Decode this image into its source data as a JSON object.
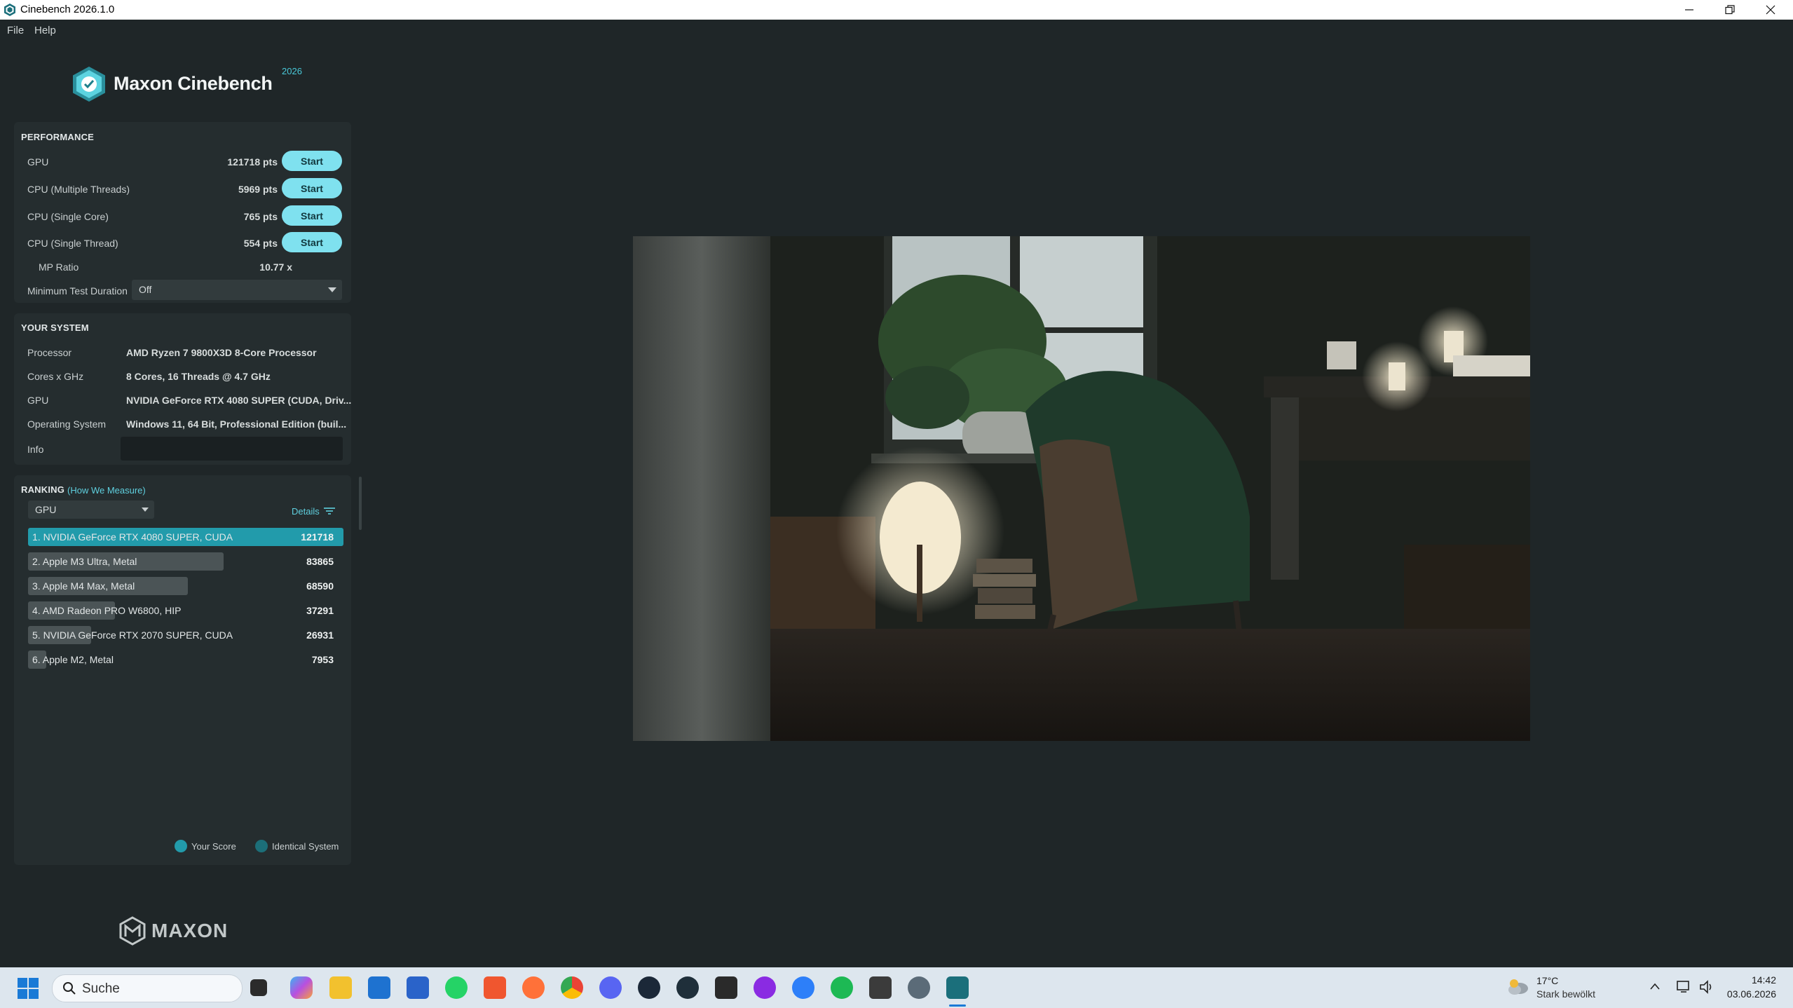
{
  "window": {
    "title": "Cinebench 2026.1.0",
    "controls": [
      "minimize",
      "restore",
      "close"
    ]
  },
  "menu": {
    "file": "File",
    "help": "Help"
  },
  "logo": {
    "brand": "Maxon Cinebench",
    "year": "2026"
  },
  "performance": {
    "heading": "PERFORMANCE",
    "tests": [
      {
        "label": "GPU",
        "score": "121718 pts",
        "button": "Start"
      },
      {
        "label": "CPU (Multiple Threads)",
        "score": "5969 pts",
        "button": "Start"
      },
      {
        "label": "CPU (Single Core)",
        "score": "765 pts",
        "button": "Start"
      },
      {
        "label": "CPU (Single Thread)",
        "score": "554 pts",
        "button": "Start"
      }
    ],
    "mp_ratio_label": "MP Ratio",
    "mp_ratio_value": "10.77 x",
    "min_duration_label": "Minimum Test Duration",
    "min_duration_value": "Off"
  },
  "system": {
    "heading": "YOUR SYSTEM",
    "rows": [
      {
        "label": "Processor",
        "value": "AMD Ryzen 7 9800X3D 8-Core Processor"
      },
      {
        "label": "Cores x GHz",
        "value": "8 Cores, 16 Threads @ 4.7 GHz"
      },
      {
        "label": "GPU",
        "value": "NVIDIA GeForce RTX 4080 SUPER (CUDA, Driv..."
      },
      {
        "label": "Operating System",
        "value": "Windows 11, 64 Bit, Professional Edition (buil..."
      }
    ],
    "info_label": "Info",
    "info_value": ""
  },
  "ranking": {
    "heading": "RANKING",
    "link": "(How We Measure)",
    "filter_value": "GPU",
    "details_label": "Details",
    "max_score": 121718,
    "entries": [
      {
        "name": "1. NVIDIA GeForce RTX 4080 SUPER, CUDA",
        "score": "121718",
        "value": 121718,
        "mine": true
      },
      {
        "name": "2. Apple M3 Ultra, Metal",
        "score": "83865",
        "value": 83865,
        "mine": false
      },
      {
        "name": "3. Apple M4 Max, Metal",
        "score": "68590",
        "value": 68590,
        "mine": false
      },
      {
        "name": "4. AMD Radeon PRO W6800, HIP",
        "score": "37291",
        "value": 37291,
        "mine": false
      },
      {
        "name": "5. NVIDIA GeForce RTX 2070 SUPER, CUDA",
        "score": "26931",
        "value": 26931,
        "mine": false
      },
      {
        "name": "6. Apple M2, Metal",
        "score": "7953",
        "value": 7953,
        "mine": false
      }
    ],
    "legend_your_score": "Your Score",
    "legend_identical": "Identical System"
  },
  "footer_logo": "MAXON",
  "taskbar": {
    "search_placeholder": "Suche",
    "weather_temp": "17°C",
    "weather_desc": "Stark bewölkt",
    "time": "14:42",
    "date": "03.06.2026"
  },
  "colors": {
    "accent": "#7fe1ef",
    "rank_mine": "#229bab",
    "rank_other": "#4b5456",
    "panel": "#252d2f",
    "background": "#1f2628"
  }
}
